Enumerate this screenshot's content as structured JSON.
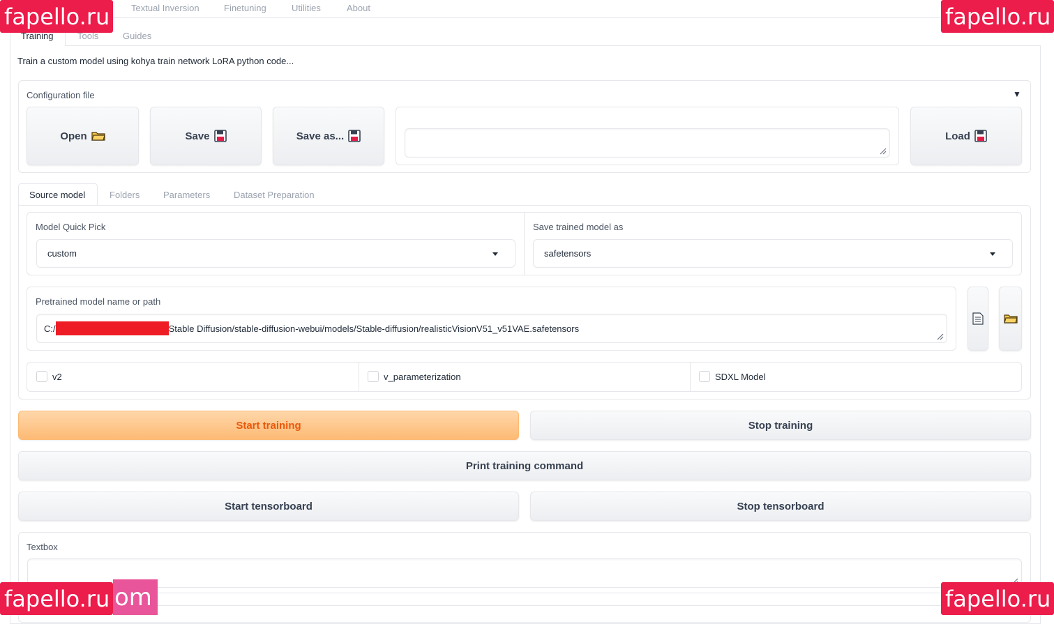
{
  "top_tabs": [
    "Textual Inversion",
    "Finetuning",
    "Utilities",
    "About"
  ],
  "sub_tabs": [
    "Training",
    "Tools",
    "Guides"
  ],
  "description": "Train a custom model using kohya train network LoRA python code...",
  "config": {
    "label": "Configuration file",
    "open_label": "Open",
    "save_label": "Save",
    "save_as_label": "Save as...",
    "load_label": "Load",
    "file_value": ""
  },
  "mid_tabs": [
    "Source model",
    "Folders",
    "Parameters",
    "Dataset Preparation"
  ],
  "source": {
    "quick_pick_label": "Model Quick Pick",
    "quick_pick_value": "custom",
    "save_as_label": "Save trained model as",
    "save_as_value": "safetensors",
    "pretrained_label": "Pretrained model name or path",
    "pretrained_prefix": "C:/",
    "pretrained_suffix": "Stable Diffusion/stable-diffusion-webui/models/Stable-diffusion/realisticVisionV51_v51VAE.safetensors"
  },
  "checkboxes": [
    "v2",
    "v_parameterization",
    "SDXL Model"
  ],
  "actions": {
    "start_training": "Start training",
    "stop_training": "Stop training",
    "print_command": "Print training command",
    "start_tensorboard": "Start tensorboard",
    "stop_tensorboard": "Stop tensorboard"
  },
  "textbox_label": "Textbox",
  "watermarks": {
    "top_left": "fapello.ru",
    "top_right": "fapello.ru",
    "bottom_left": "fapello.ru",
    "bottom_left_suffix": "om",
    "bottom_right": "fapello.ru"
  },
  "colors": {
    "accent_orange": "#ea580c",
    "watermark": "#ec1c4b"
  }
}
